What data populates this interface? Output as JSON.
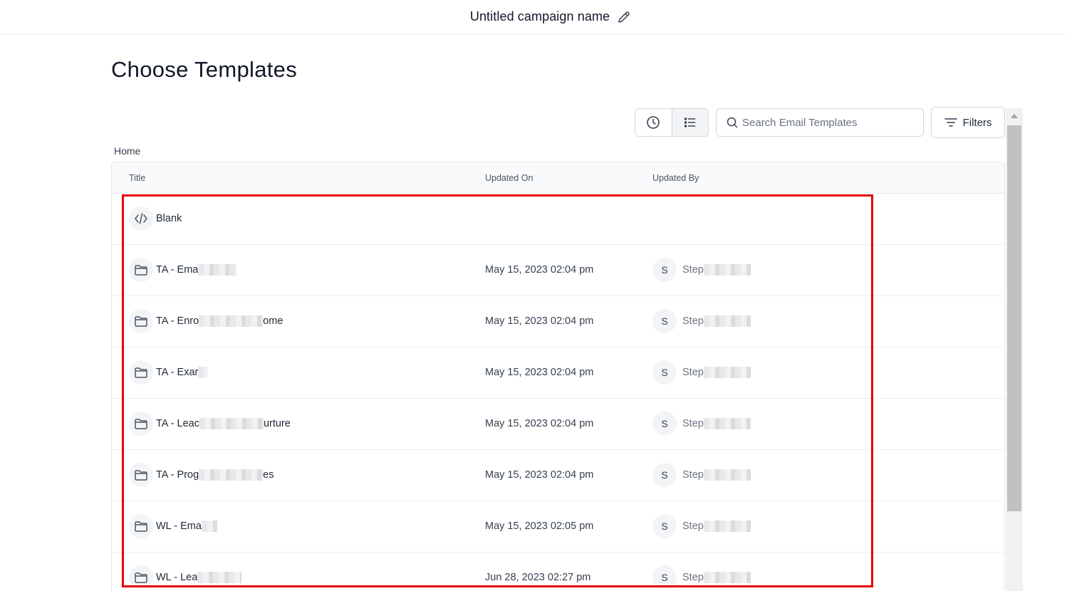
{
  "topbar": {
    "campaign_name": "Untitled campaign name",
    "edit_icon": "pencil-icon"
  },
  "page": {
    "title": "Choose Templates"
  },
  "toolbar": {
    "recent_icon": "clock-icon",
    "list_icon": "list-icon",
    "search_placeholder": "Search Email Templates",
    "filters_label": "Filters"
  },
  "breadcrumb": "Home",
  "table": {
    "columns": {
      "title": "Title",
      "updated_on": "Updated On",
      "updated_by": "Updated By"
    },
    "rows": [
      {
        "icon": "code-icon",
        "title": "Blank",
        "updated_on": "",
        "avatar": "",
        "updated_by": ""
      },
      {
        "icon": "folder-icon",
        "title": "TA - Ema",
        "title_suffix": "",
        "updated_on": "May 15, 2023 02:04 pm",
        "avatar": "S",
        "updated_by": "Step"
      },
      {
        "icon": "folder-icon",
        "title": "TA - Enro",
        "title_suffix": "ome",
        "updated_on": "May 15, 2023 02:04 pm",
        "avatar": "S",
        "updated_by": "Step"
      },
      {
        "icon": "folder-icon",
        "title": "TA - Exar",
        "title_suffix": "",
        "updated_on": "May 15, 2023 02:04 pm",
        "avatar": "S",
        "updated_by": "Step"
      },
      {
        "icon": "folder-icon",
        "title": "TA - Leac",
        "title_suffix": "urture",
        "updated_on": "May 15, 2023 02:04 pm",
        "avatar": "S",
        "updated_by": "Step"
      },
      {
        "icon": "folder-icon",
        "title": "TA - Prog",
        "title_suffix": "es",
        "updated_on": "May 15, 2023 02:04 pm",
        "avatar": "S",
        "updated_by": "Step"
      },
      {
        "icon": "folder-icon",
        "title": "WL - Ema",
        "title_suffix": "",
        "updated_on": "May 15, 2023 02:05 pm",
        "avatar": "S",
        "updated_by": "Step"
      },
      {
        "icon": "folder-icon",
        "title": "WL - Lea",
        "title_suffix": "",
        "updated_on": "Jun 28, 2023 02:27 pm",
        "avatar": "S",
        "updated_by": "Step"
      }
    ]
  },
  "colors": {
    "highlight": "#e60000",
    "header_bg": "#f9fafb",
    "border": "#e5e7eb"
  }
}
